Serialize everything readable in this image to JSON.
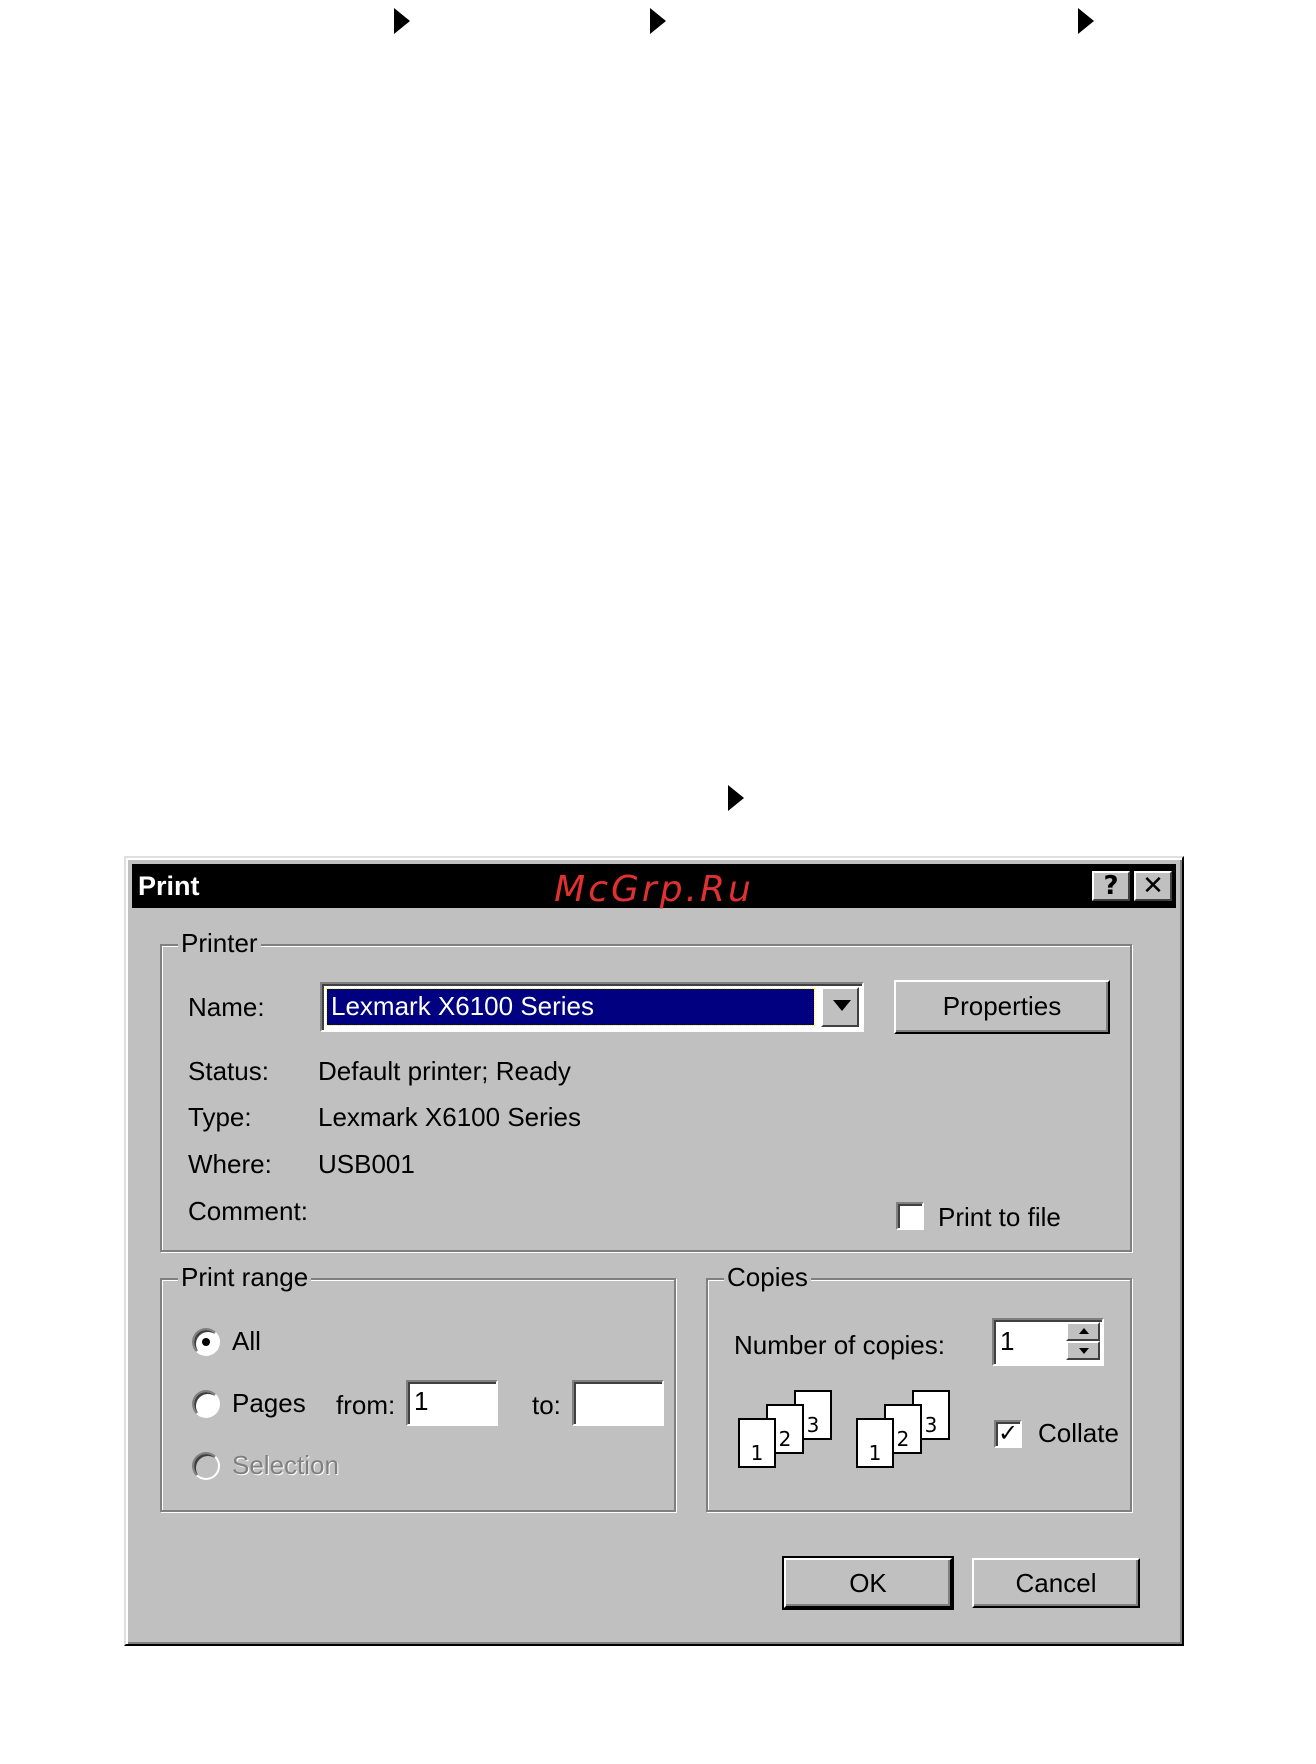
{
  "dialog": {
    "title": "Print",
    "watermark": "McGrp.Ru",
    "help_button": "?",
    "close_button": "✕"
  },
  "printer": {
    "legend": "Printer",
    "name_label": "Name:",
    "name_value": "Lexmark X6100 Series",
    "properties_button": "Properties",
    "status_label": "Status:",
    "status_value": "Default printer; Ready",
    "type_label": "Type:",
    "type_value": "Lexmark X6100 Series",
    "where_label": "Where:",
    "where_value": "USB001",
    "comment_label": "Comment:",
    "comment_value": "",
    "print_to_file_label": "Print to file",
    "print_to_file_checked": false
  },
  "print_range": {
    "legend": "Print range",
    "all_label": "All",
    "pages_label": "Pages",
    "from_label": "from:",
    "from_value": "1",
    "to_label": "to:",
    "to_value": "",
    "selection_label": "Selection",
    "selected": "all"
  },
  "copies": {
    "legend": "Copies",
    "number_label": "Number of copies:",
    "number_value": "1",
    "collate_label": "Collate",
    "collate_checked": true,
    "collate_pages": [
      "1",
      "2",
      "3"
    ]
  },
  "buttons": {
    "ok": "OK",
    "cancel": "Cancel"
  },
  "icons": {
    "bullet_arrow": "triangle-right-icon",
    "dropdown": "chevron-down-icon",
    "check": "checkmark-icon"
  }
}
